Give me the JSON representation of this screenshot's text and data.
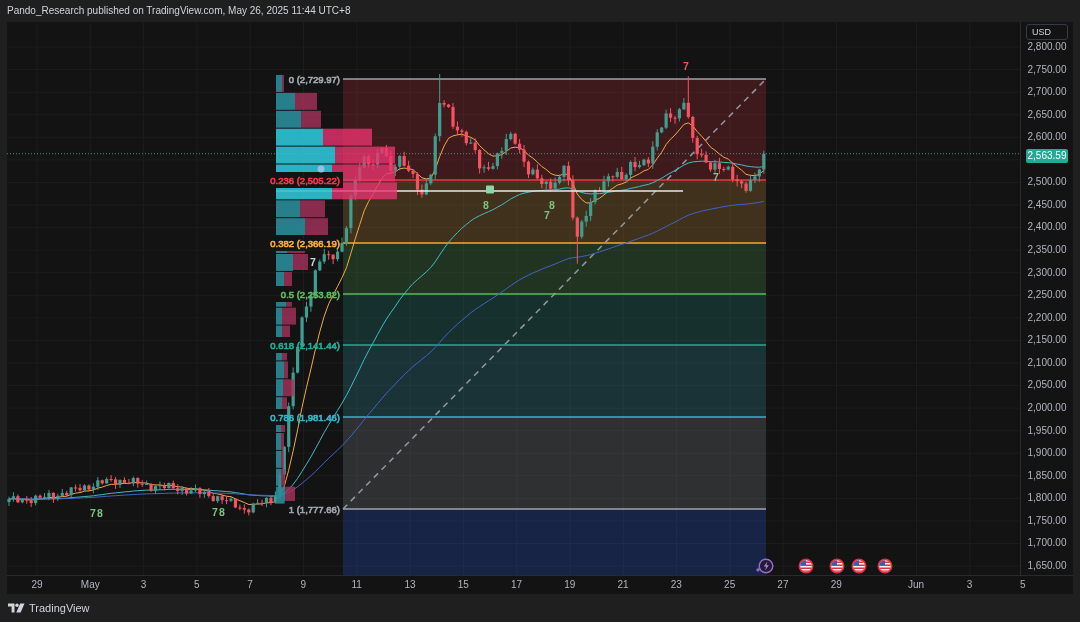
{
  "header": {
    "attribution": "Pando_Research published on TradingView.com, May 26, 2025 11:44 UTC+8"
  },
  "chart": {
    "fib_levels": [
      {
        "label": "0 (2,729.97)",
        "color": "#a0a3ab"
      },
      {
        "label": "0.236 (2,505.22)",
        "color": "#f23645"
      },
      {
        "label": "0.382 (2,366.19)",
        "color": "#f2a93b"
      },
      {
        "label": "0.5 (2,253.82)",
        "color": "#5cb85c"
      },
      {
        "label": "0.618 (2,141.44)",
        "color": "#22ab94"
      },
      {
        "label": "0.786 (1,981.46)",
        "color": "#35b3c8"
      },
      {
        "label": "1 (1,777.66)",
        "color": "#a0a3ab"
      }
    ],
    "count_markers": [
      {
        "label": "7",
        "color": "#f7525f"
      },
      {
        "label": "7",
        "color": "#8fbf8f"
      },
      {
        "label": "8",
        "color": "#7cc47f"
      },
      {
        "label": "8",
        "color": "#7cc47f"
      },
      {
        "label": "7",
        "color": "#7cc47f"
      },
      {
        "label": "7",
        "color": "#d1d4dc"
      },
      {
        "label": "7",
        "color": "#7cc47f"
      },
      {
        "label": "8",
        "color": "#7cc47f"
      },
      {
        "label": "7",
        "color": "#7cc47f"
      },
      {
        "label": "8",
        "color": "#7cc47f"
      }
    ]
  },
  "price_axis": {
    "currency": "USD",
    "ticks_above": [
      "2,800.00",
      "2,750.00",
      "2,700.00",
      "2,650.00",
      "2,600.00"
    ],
    "current_price": "2,563.59",
    "ticks_below": [
      "2,500.00",
      "2,450.00",
      "2,400.00",
      "2,350.00",
      "2,300.00",
      "2,250.00",
      "2,200.00",
      "2,150.00",
      "2,100.00",
      "2,050.00",
      "2,000.00",
      "1,950.00",
      "1,900.00",
      "1,850.00",
      "1,800.00",
      "1,750.00",
      "1,700.00",
      "1,650.00"
    ]
  },
  "time_axis": {
    "labels": [
      "29",
      "May",
      "3",
      "5",
      "7",
      "9",
      "11",
      "13",
      "15",
      "17",
      "19",
      "21",
      "23",
      "25",
      "27",
      "29",
      "Jun",
      "3",
      "5"
    ]
  },
  "footer": {
    "brand": "TradingView"
  }
}
